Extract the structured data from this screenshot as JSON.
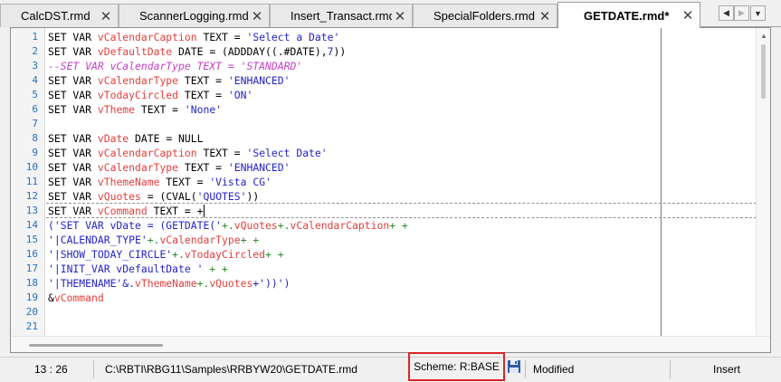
{
  "tabs": [
    {
      "label": "CalcDST.rmd",
      "active": false
    },
    {
      "label": "ScannerLogging.rmd",
      "active": false
    },
    {
      "label": "Insert_Transact.rmd",
      "active": false
    },
    {
      "label": "SpecialFolders.rmd",
      "active": false
    },
    {
      "label": "GETDATE.rmd*",
      "active": true
    }
  ],
  "tab_nav": {
    "left_icon": "arrow-left-icon",
    "right_icon": "arrow-right-icon",
    "menu_icon": "dropdown-arrow-icon"
  },
  "editor": {
    "line_numbers": [
      "1",
      "2",
      "3",
      "4",
      "5",
      "6",
      "7",
      "8",
      "9",
      "10",
      "11",
      "12",
      "13",
      "14",
      "15",
      "16",
      "17",
      "18",
      "19",
      "20",
      "21"
    ],
    "lines": [
      [
        {
          "t": "SET VAR ",
          "c": "kw"
        },
        {
          "t": "vCalendarCaption",
          "c": "var"
        },
        {
          "t": " TEXT = ",
          "c": "kw"
        },
        {
          "t": "'Select a Date'",
          "c": "str"
        }
      ],
      [
        {
          "t": "SET VAR ",
          "c": "kw"
        },
        {
          "t": "vDefaultDate",
          "c": "var"
        },
        {
          "t": " DATE = (ADDDAY((.#DATE),",
          "c": "kw"
        },
        {
          "t": "7",
          "c": "num"
        },
        {
          "t": "))",
          "c": "kw"
        }
      ],
      [
        {
          "t": "--SET VAR vCalendarType TEXT = 'STANDARD'",
          "c": "cm"
        }
      ],
      [
        {
          "t": "SET VAR ",
          "c": "kw"
        },
        {
          "t": "vCalendarType",
          "c": "var"
        },
        {
          "t": " TEXT = ",
          "c": "kw"
        },
        {
          "t": "'ENHANCED'",
          "c": "str"
        }
      ],
      [
        {
          "t": "SET VAR ",
          "c": "kw"
        },
        {
          "t": "vTodayCircled",
          "c": "var"
        },
        {
          "t": " TEXT = ",
          "c": "kw"
        },
        {
          "t": "'ON'",
          "c": "str"
        }
      ],
      [
        {
          "t": "SET VAR ",
          "c": "kw"
        },
        {
          "t": "vTheme",
          "c": "var"
        },
        {
          "t": " TEXT = ",
          "c": "kw"
        },
        {
          "t": "'None'",
          "c": "str"
        }
      ],
      [],
      [
        {
          "t": "SET VAR ",
          "c": "kw"
        },
        {
          "t": "vDate",
          "c": "var"
        },
        {
          "t": " DATE = NULL",
          "c": "kw"
        }
      ],
      [
        {
          "t": "SET VAR ",
          "c": "kw"
        },
        {
          "t": "vCalendarCaption",
          "c": "var"
        },
        {
          "t": " TEXT = ",
          "c": "kw"
        },
        {
          "t": "'Select Date'",
          "c": "str"
        }
      ],
      [
        {
          "t": "SET VAR ",
          "c": "kw"
        },
        {
          "t": "vCalendarType",
          "c": "var"
        },
        {
          "t": " TEXT = ",
          "c": "kw"
        },
        {
          "t": "'ENHANCED'",
          "c": "str"
        }
      ],
      [
        {
          "t": "SET VAR ",
          "c": "kw"
        },
        {
          "t": "vThemeName",
          "c": "var"
        },
        {
          "t": " TEXT = ",
          "c": "kw"
        },
        {
          "t": "'Vista CG'",
          "c": "str"
        }
      ],
      [
        {
          "t": "SET VAR ",
          "c": "kw"
        },
        {
          "t": "vQuotes",
          "c": "var"
        },
        {
          "t": " = (CVAL(",
          "c": "kw"
        },
        {
          "t": "'QUOTES'",
          "c": "str"
        },
        {
          "t": "))",
          "c": "kw"
        }
      ],
      [
        {
          "t": "SET VAR ",
          "c": "kw"
        },
        {
          "t": "vCommand",
          "c": "var"
        },
        {
          "t": " TEXT = +",
          "c": "kw"
        }
      ],
      [
        {
          "t": "('SET VAR vDate = (GETDATE('",
          "c": "str"
        },
        {
          "t": "+.",
          "c": "plus"
        },
        {
          "t": "vQuotes",
          "c": "var"
        },
        {
          "t": "+.",
          "c": "plus"
        },
        {
          "t": "vCalendarCaption",
          "c": "var"
        },
        {
          "t": "+ +",
          "c": "plus"
        }
      ],
      [
        {
          "t": "'|CALENDAR_TYPE'",
          "c": "str"
        },
        {
          "t": "+.",
          "c": "plus"
        },
        {
          "t": "vCalendarType",
          "c": "var"
        },
        {
          "t": "+ +",
          "c": "plus"
        }
      ],
      [
        {
          "t": "'|SHOW_TODAY_CIRCLE'",
          "c": "str"
        },
        {
          "t": "+.",
          "c": "plus"
        },
        {
          "t": "vTodayCircled",
          "c": "var"
        },
        {
          "t": "+ +",
          "c": "plus"
        }
      ],
      [
        {
          "t": "'|INIT_VAR vDefaultDate '",
          "c": "str"
        },
        {
          "t": " + +",
          "c": "plus"
        }
      ],
      [
        {
          "t": "'|THEMENAME'&.",
          "c": "str"
        },
        {
          "t": "vThemeName",
          "c": "var"
        },
        {
          "t": "+.",
          "c": "plus"
        },
        {
          "t": "vQuotes",
          "c": "var"
        },
        {
          "t": "+'))')",
          "c": "str"
        }
      ],
      [
        {
          "t": "&",
          "c": "kw"
        },
        {
          "t": "vCommand",
          "c": "var"
        }
      ],
      [],
      []
    ]
  },
  "status": {
    "position": "13 : 26",
    "file_path": "C:\\RBTI\\RBG11\\Samples\\RRBYW20\\GETDATE.rmd",
    "scheme": "Scheme: R:BASE",
    "save_icon": "floppy-disk-icon",
    "modified": "Modified",
    "insert_mode": "Insert"
  },
  "colors": {
    "keyword": "#000000",
    "variable": "#e2403d",
    "string": "#2323c8",
    "comment": "#c23fc2",
    "line_number": "#2a6fb5",
    "highlight_box": "#d8252b"
  }
}
